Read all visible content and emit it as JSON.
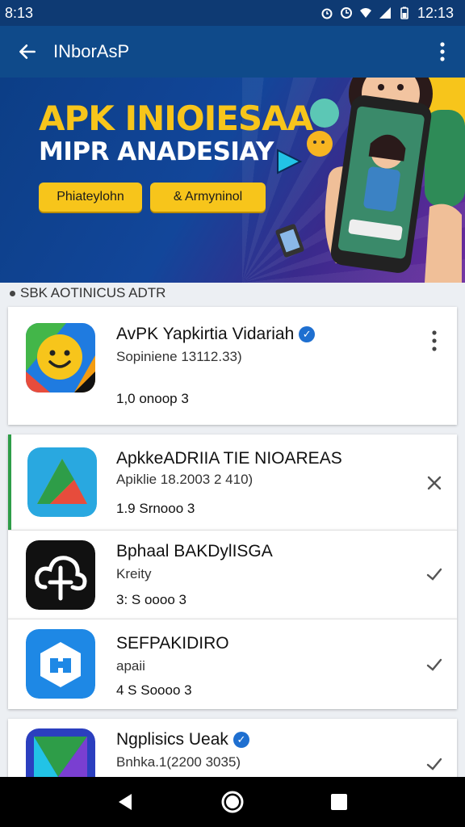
{
  "status_bar": {
    "time_left": "8:13",
    "time_right": "12:13"
  },
  "app_bar": {
    "title": "INborAsP"
  },
  "hero": {
    "headline": "APK INIOIESAA",
    "subheadline": "MIPR ANADESIAY",
    "button_1": "Phiateylohn",
    "button_2": "& Armyninol"
  },
  "section": {
    "label": "SBK AOTINICUS ADTR"
  },
  "apps": [
    {
      "name": "AvPK Yapkirtia Vidariah",
      "verified": true,
      "subtitle": "Sopiniene 13112.33)",
      "meta": "1,0 onoop  3",
      "action": "more"
    },
    {
      "name": "ApkkeADRIIA TIE NIOAREAS",
      "verified": false,
      "subtitle": "Apiklie 18.2003 2 410)",
      "meta": "1.9 Srnooo  3",
      "action": "close"
    },
    {
      "name": "Bphaal BAKDylISGA",
      "verified": false,
      "subtitle": "Kreity",
      "meta": "3: S oooo  3",
      "action": "check"
    },
    {
      "name": "SEFPAKIDIRO",
      "verified": false,
      "subtitle": "apaii",
      "meta": "4 S Soooo  3",
      "action": "check"
    },
    {
      "name": "Ngplisics Ueak",
      "verified": true,
      "subtitle": "Bnhka.1(2200 3035)",
      "meta": "",
      "action": "check"
    }
  ],
  "colors": {
    "appbar": "#0f4a8a",
    "accent": "#f7c51b",
    "verified": "#1e6fd0"
  }
}
